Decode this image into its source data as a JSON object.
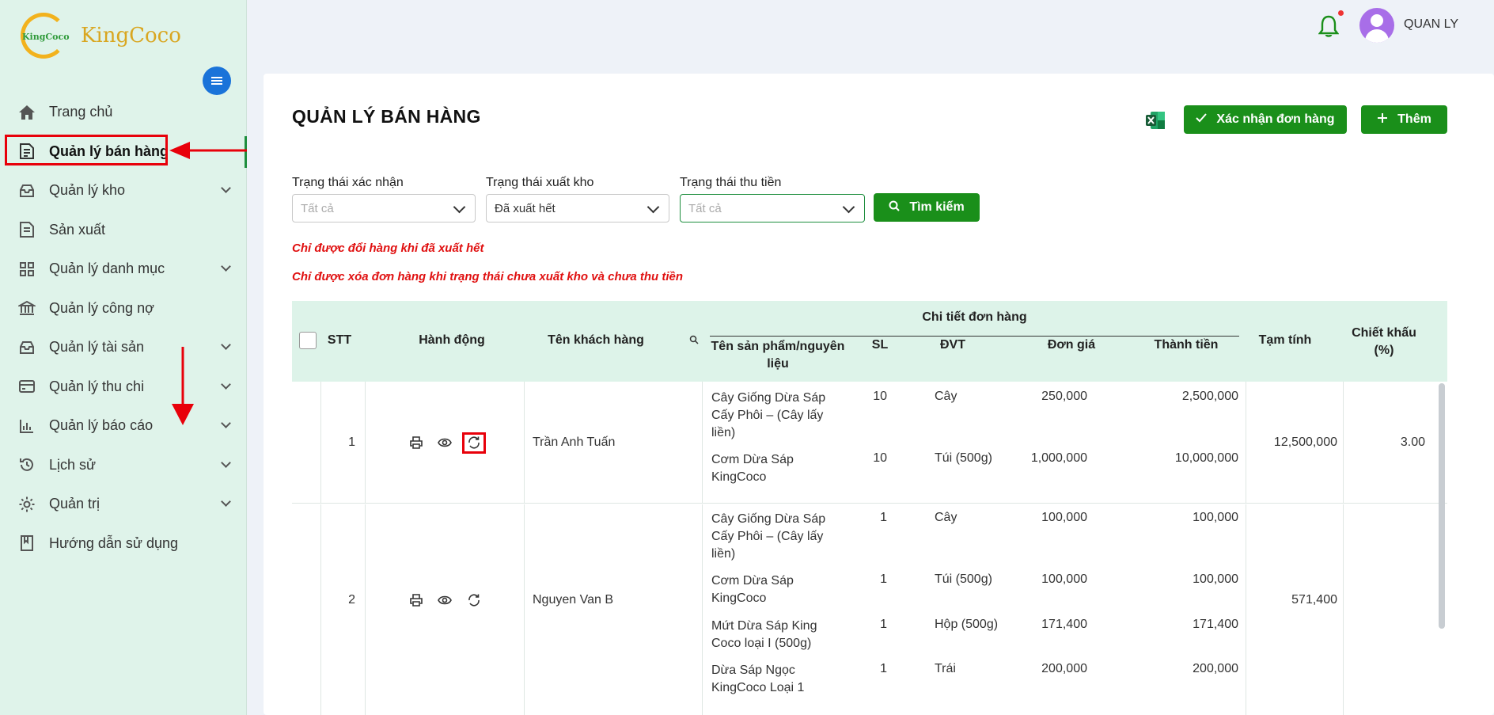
{
  "app": {
    "logo_text": "KingCoco",
    "logo_mark_text": "KingCoco"
  },
  "sidebar": {
    "items": [
      {
        "label": "Trang chủ",
        "icon": "home-icon",
        "has_submenu": false
      },
      {
        "label": "Quản lý bán hàng",
        "icon": "sales-icon",
        "has_submenu": false,
        "active": true
      },
      {
        "label": "Quản lý kho",
        "icon": "inbox-icon",
        "has_submenu": true
      },
      {
        "label": "Sản xuất",
        "icon": "production-icon",
        "has_submenu": false
      },
      {
        "label": "Quản lý danh mục",
        "icon": "grid-icon",
        "has_submenu": true
      },
      {
        "label": "Quản lý công nợ",
        "icon": "bank-icon",
        "has_submenu": false
      },
      {
        "label": "Quản lý tài sản",
        "icon": "inbox-icon",
        "has_submenu": true
      },
      {
        "label": "Quản lý thu chi",
        "icon": "card-icon",
        "has_submenu": true
      },
      {
        "label": "Quản lý báo cáo",
        "icon": "chart-icon",
        "has_submenu": true
      },
      {
        "label": "Lịch sử",
        "icon": "history-icon",
        "has_submenu": true
      },
      {
        "label": "Quản trị",
        "icon": "gear-icon",
        "has_submenu": true
      },
      {
        "label": "Hướng dẫn sử dụng",
        "icon": "book-icon",
        "has_submenu": false
      }
    ]
  },
  "header": {
    "user_name": "QUAN LY"
  },
  "main": {
    "title": "QUẢN LÝ BÁN HÀNG",
    "confirm_label": "Xác nhận đơn hàng",
    "add_label": "Thêm",
    "filters": {
      "confirm_status": {
        "label": "Trạng thái xác nhận",
        "value": "Tất cả",
        "is_placeholder": true
      },
      "export_status": {
        "label": "Trạng thái xuất kho",
        "value": "Đã xuất hết",
        "is_placeholder": false
      },
      "payment_status": {
        "label": "Trạng thái thu tiền",
        "value": "Tất cả",
        "is_placeholder": true
      }
    },
    "search_label": "Tìm kiếm",
    "notes": [
      "Chỉ được đổi hàng khi đã xuất hết",
      "Chỉ được xóa đơn hàng khi trạng thái chưa xuất kho và chưa thu tiền"
    ]
  },
  "table": {
    "headers": {
      "stt": "STT",
      "actions": "Hành động",
      "customer": "Tên khách hàng",
      "detail_group": "Chi tiết đơn hàng",
      "product": "Tên sản phẩm/nguyên liệu",
      "qty": "SL",
      "unit": "ĐVT",
      "price": "Đơn giá",
      "amount": "Thành tiền",
      "subtotal": "Tạm tính",
      "discount": "Chiết khấu (%)"
    },
    "rows": [
      {
        "stt": "1",
        "customer": "Trần Anh Tuấn",
        "subtotal": "12,500,000",
        "discount": "3.00",
        "items": [
          {
            "product": "Cây Giống Dừa Sáp Cấy Phôi – (Cây lấy liền)",
            "qty": "10",
            "unit": "Cây",
            "price": "250,000",
            "amount": "2,500,000"
          },
          {
            "product": "Cơm Dừa Sáp KingCoco",
            "qty": "10",
            "unit": "Túi (500g)",
            "price": "1,000,000",
            "amount": "10,000,000"
          }
        ]
      },
      {
        "stt": "2",
        "customer": "Nguyen Van B",
        "subtotal": "571,400",
        "discount": "",
        "items": [
          {
            "product": "Cây Giống Dừa Sáp Cấy Phôi – (Cây lấy liền)",
            "qty": "1",
            "unit": "Cây",
            "price": "100,000",
            "amount": "100,000"
          },
          {
            "product": "Cơm Dừa Sáp KingCoco",
            "qty": "1",
            "unit": "Túi (500g)",
            "price": "100,000",
            "amount": "100,000"
          },
          {
            "product": "Mứt Dừa Sáp King Coco loại I (500g)",
            "qty": "1",
            "unit": "Hộp (500g)",
            "price": "171,400",
            "amount": "171,400"
          },
          {
            "product": "Dừa Sáp Ngọc KingCoco Loại 1",
            "qty": "1",
            "unit": "Trái",
            "price": "200,000",
            "amount": "200,000"
          }
        ]
      }
    ]
  },
  "colors": {
    "primary_green": "#1a8f1a",
    "sidebar_bg": "#dff3ea",
    "highlight_red": "#e8000a",
    "avatar": "#a86ee8"
  }
}
